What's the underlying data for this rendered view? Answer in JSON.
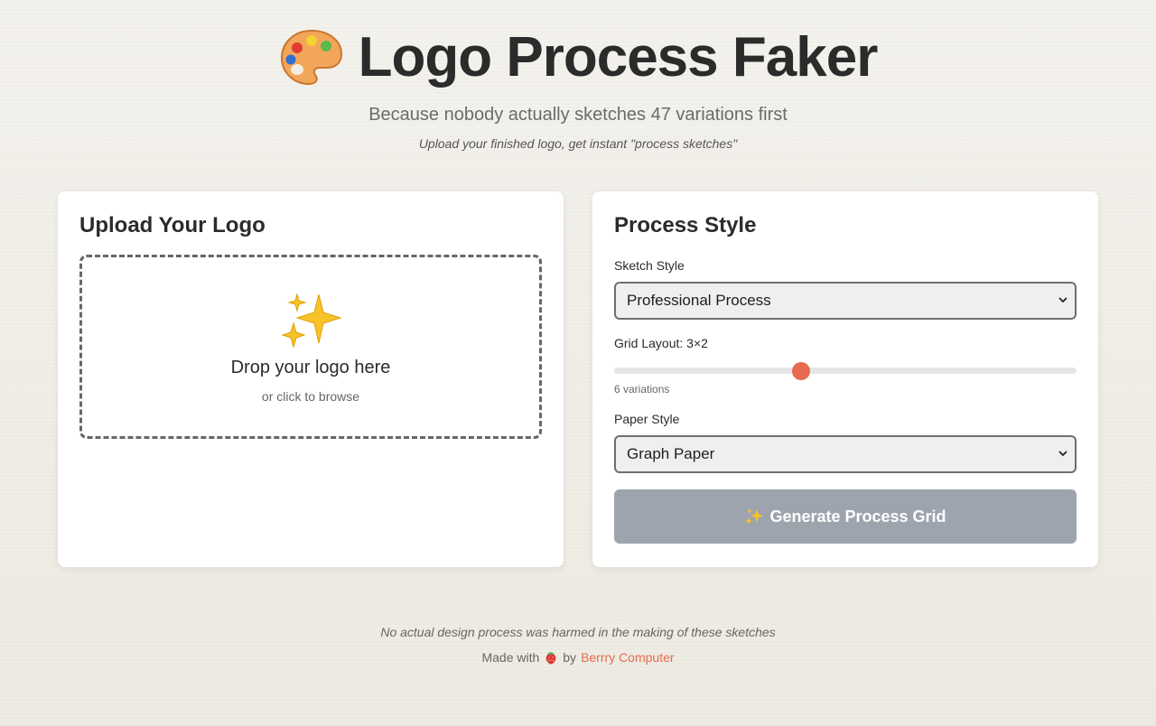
{
  "header": {
    "title": "Logo Process Faker",
    "subtitle": "Because nobody actually sketches 47 variations first",
    "tagline": "Upload your finished logo, get instant \"process sketches\""
  },
  "upload": {
    "heading": "Upload Your Logo",
    "drop_title": "Drop your logo here",
    "drop_sub": "or click to browse",
    "icon": "sparkles-icon"
  },
  "style": {
    "heading": "Process Style",
    "sketch_label": "Sketch Style",
    "sketch_value": "Professional Process",
    "grid_label": "Grid Layout: 3×2",
    "grid_fraction": 0.405,
    "grid_hint": "6 variations",
    "paper_label": "Paper Style",
    "paper_value": "Graph Paper",
    "generate_label": "Generate Process Grid"
  },
  "footer": {
    "note": "No actual design process was harmed in the making of these sketches",
    "made_with": "Made with",
    "by": "by",
    "brand": "Berrry Computer"
  },
  "colors": {
    "accent": "#e66b4f",
    "button_disabled": "#9ea4ae",
    "text": "#2b2b2b"
  }
}
